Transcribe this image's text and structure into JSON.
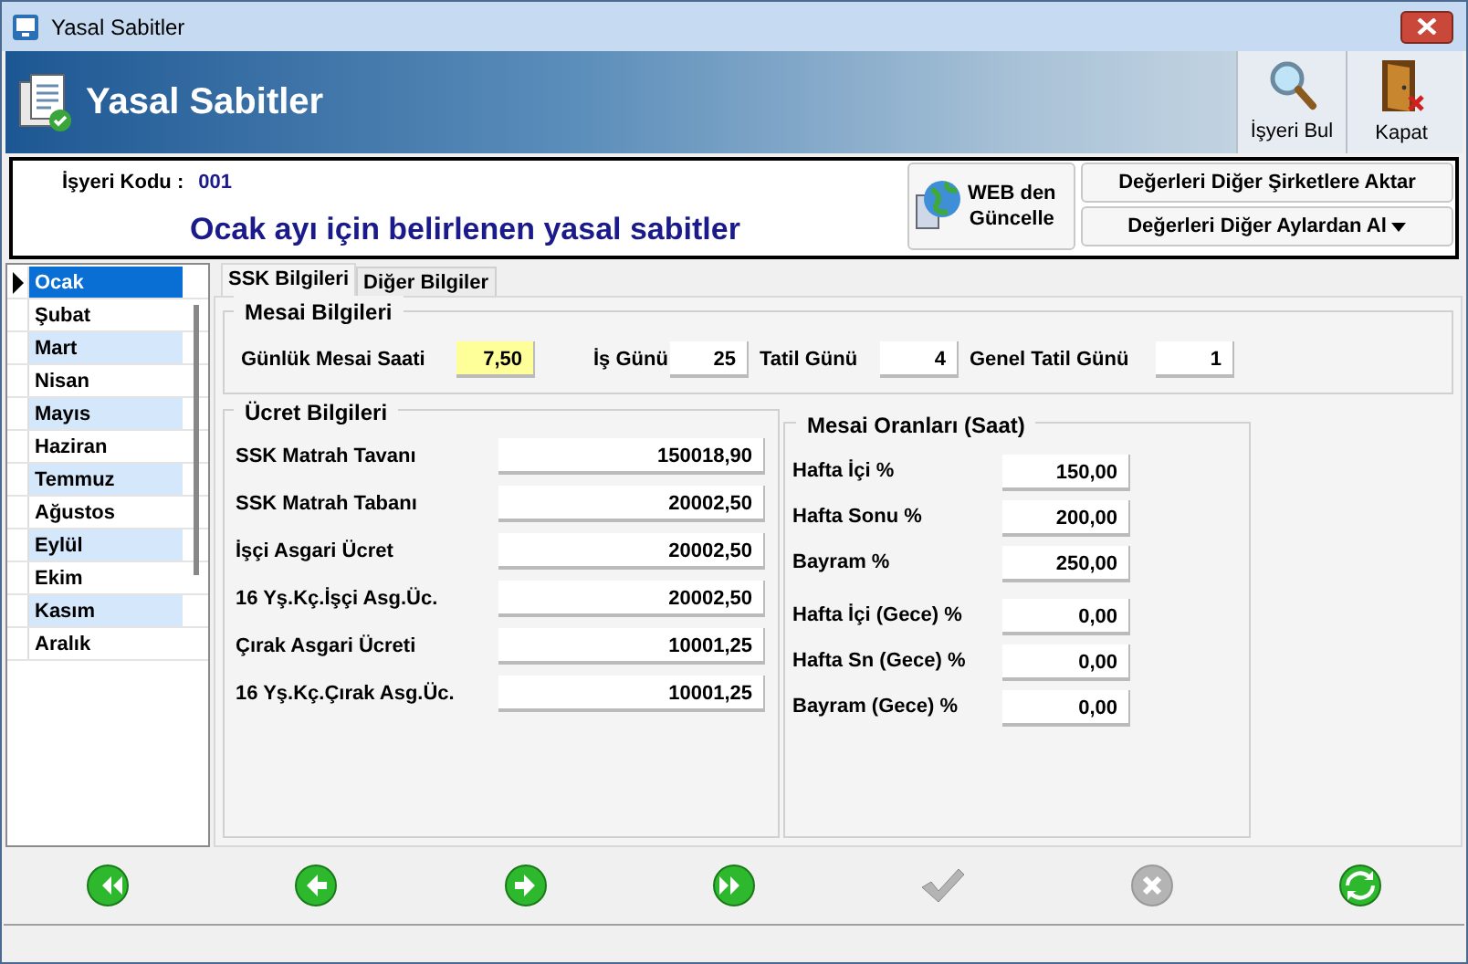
{
  "window": {
    "title": "Yasal Sabitler"
  },
  "header": {
    "title": "Yasal Sabitler",
    "tools": [
      {
        "kind": "find",
        "label": "İşyeri Bul"
      },
      {
        "kind": "close",
        "label": "Kapat"
      }
    ]
  },
  "info": {
    "code_label": "İşyeri Kodu :",
    "code": "001",
    "heading": "Ocak ayı için belirlenen yasal sabitler",
    "web_button": [
      "WEB den",
      "Güncelle"
    ],
    "actions": [
      {
        "label": "Değerleri Diğer Şirketlere Aktar",
        "dropdown": false
      },
      {
        "label": "Değerleri Diğer Aylardan Al",
        "dropdown": true
      }
    ]
  },
  "months": [
    {
      "label": "Ocak",
      "selected": true
    },
    {
      "label": "Şubat",
      "selected": false
    },
    {
      "label": "Mart",
      "selected": false
    },
    {
      "label": "Nisan",
      "selected": false
    },
    {
      "label": "Mayıs",
      "selected": false
    },
    {
      "label": "Haziran",
      "selected": false
    },
    {
      "label": "Temmuz",
      "selected": false
    },
    {
      "label": "Ağustos",
      "selected": false
    },
    {
      "label": "Eylül",
      "selected": false
    },
    {
      "label": "Ekim",
      "selected": false
    },
    {
      "label": "Kasım",
      "selected": false
    },
    {
      "label": "Aralık",
      "selected": false
    }
  ],
  "tabs": [
    {
      "label": "SSK Bilgileri",
      "selected": true
    },
    {
      "label": "Diğer Bilgiler",
      "selected": false
    }
  ],
  "mesai": {
    "title": "Mesai Bilgileri",
    "fields": [
      {
        "label": "Günlük Mesai Saati",
        "value": "7,50",
        "focused": true
      },
      {
        "label": "İş Günü",
        "value": "25",
        "focused": false
      },
      {
        "label": "Tatil Günü",
        "value": "4",
        "focused": false
      },
      {
        "label": "Genel Tatil Günü",
        "value": "1",
        "focused": false
      }
    ]
  },
  "ucret": {
    "title": "Ücret Bilgileri",
    "fields": [
      {
        "label": "SSK Matrah Tavanı",
        "value": "150018,90"
      },
      {
        "label": "SSK Matrah Tabanı",
        "value": "20002,50"
      },
      {
        "label": "İşçi Asgari Ücret",
        "value": "20002,50"
      },
      {
        "label": "16 Yş.Kç.İşçi Asg.Üc.",
        "value": "20002,50"
      },
      {
        "label": "Çırak Asgari Ücreti",
        "value": "10001,25"
      },
      {
        "label": "16 Yş.Kç.Çırak Asg.Üc.",
        "value": "10001,25"
      }
    ]
  },
  "oranlar": {
    "title": "Mesai Oranları (Saat)",
    "groups": [
      [
        {
          "label": "Hafta İçi %",
          "value": "150,00"
        },
        {
          "label": "Hafta Sonu %",
          "value": "200,00"
        },
        {
          "label": "Bayram %",
          "value": "250,00"
        }
      ],
      [
        {
          "label": "Hafta İçi (Gece) %",
          "value": "0,00"
        },
        {
          "label": "Hafta Sn (Gece) %",
          "value": "0,00"
        },
        {
          "label": "Bayram (Gece) %",
          "value": "0,00"
        }
      ]
    ]
  },
  "nav": [
    {
      "kind": "first",
      "disabled": false
    },
    {
      "kind": "prev",
      "disabled": false
    },
    {
      "kind": "next",
      "disabled": false
    },
    {
      "kind": "last",
      "disabled": false
    },
    {
      "kind": "save",
      "disabled": true
    },
    {
      "kind": "cancel",
      "disabled": true
    },
    {
      "kind": "refresh",
      "disabled": false
    }
  ]
}
